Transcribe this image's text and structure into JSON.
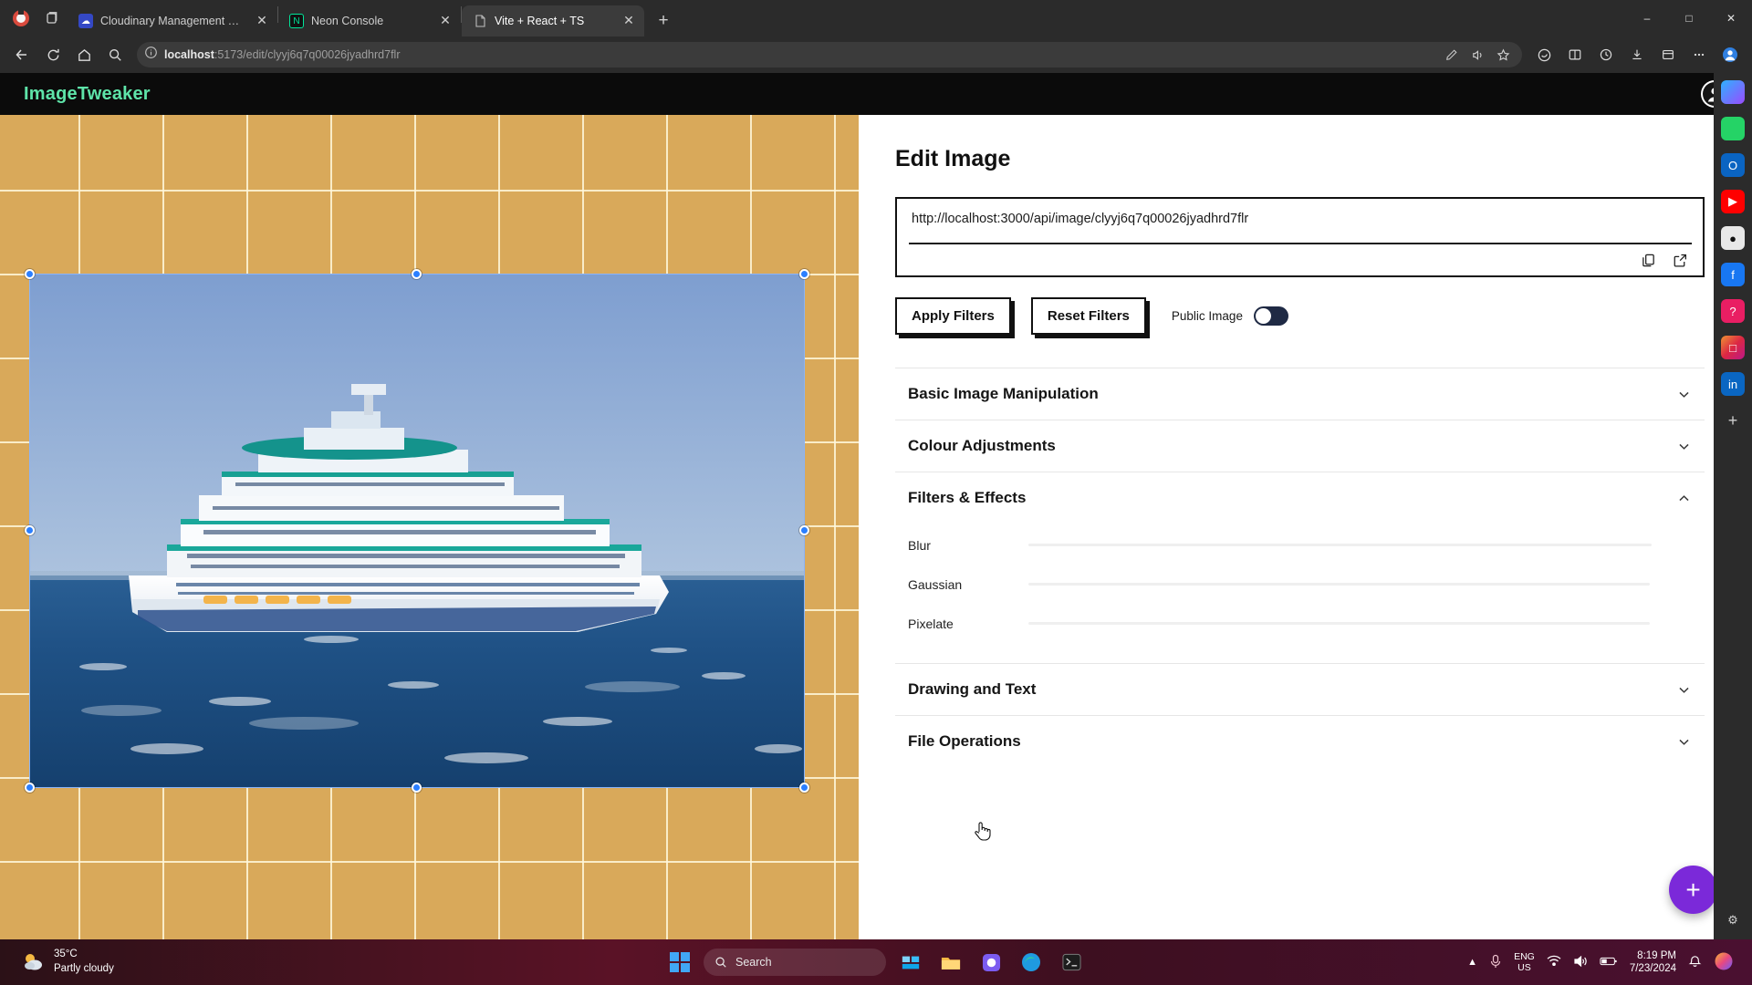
{
  "browser": {
    "tabs": [
      {
        "label": "Cloudinary Management Console",
        "active": false,
        "favicon": "cloudinary-icon",
        "favicon_color": "#3448c5"
      },
      {
        "label": "Neon Console",
        "active": false,
        "favicon": "neon-icon",
        "favicon_color": "#111111"
      },
      {
        "label": "Vite + React + TS",
        "active": true,
        "favicon": "document-icon",
        "favicon_color": "#555555"
      }
    ],
    "new_tab_label": "+",
    "window_controls": {
      "minimize": "–",
      "maximize": "□",
      "close": "✕"
    },
    "nav": {
      "back_icon": "back-arrow-icon",
      "refresh_icon": "refresh-icon",
      "home_icon": "home-icon",
      "search_icon": "search-icon"
    },
    "address": {
      "info_icon": "info-circle-icon",
      "host": "localhost",
      "path": ":5173/edit/clyyj6q7q00026jyadhrd7flr",
      "full_url": "localhost:5173/edit/clyyj6q7q00026jyadhrd7flr"
    },
    "omni_actions": [
      "pen-icon",
      "read-aloud-icon",
      "favorite-star-icon"
    ],
    "toolbar_right": [
      "copilot-icon",
      "split-screen-icon",
      "history-icon",
      "downloads-icon",
      "collections-icon",
      "more-icon",
      "profile-icon"
    ],
    "sidebar_icons": [
      "copilot-icon",
      "whatsapp-icon",
      "outlook-icon",
      "youtube-icon",
      "github-icon",
      "facebook-icon",
      "help-icon",
      "instagram-icon",
      "linkedin-icon",
      "add-icon",
      "settings-icon"
    ]
  },
  "app": {
    "brand": "ImageTweaker",
    "avatar_icon": "user-avatar-icon"
  },
  "editor": {
    "title": "Edit Image",
    "image_url": "http://localhost:3000/api/image/clyyj6q7q00026jyadhrd7flr",
    "url_actions": [
      {
        "name": "copy-icon",
        "label": "Copy"
      },
      {
        "name": "open-external-icon",
        "label": "Open in new tab"
      }
    ],
    "apply_button": "Apply Filters",
    "reset_button": "Reset Filters",
    "public_toggle_label": "Public Image",
    "public_toggle_on": true,
    "accordions": [
      {
        "title": "Basic Image Manipulation",
        "expanded": false,
        "chevron": "chevron-down-icon"
      },
      {
        "title": "Colour Adjustments",
        "expanded": false,
        "chevron": "chevron-down-icon"
      },
      {
        "title": "Filters & Effects",
        "expanded": true,
        "chevron": "chevron-up-icon",
        "sliders": [
          {
            "label": "Blur",
            "value": 0
          },
          {
            "label": "Gaussian",
            "value": 0
          },
          {
            "label": "Pixelate",
            "value": 0
          }
        ]
      },
      {
        "title": "Drawing and Text",
        "expanded": false,
        "chevron": "chevron-down-icon"
      },
      {
        "title": "File Operations",
        "expanded": false,
        "chevron": "chevron-down-icon"
      }
    ],
    "fab_label": "+",
    "fab_color": "#7b29d9",
    "canvas": {
      "background_color": "#d9a95a",
      "grid_line_color": "#fff8dc",
      "selection_color": "#2b7fff",
      "subject": "cruise ship on ocean photo"
    }
  },
  "taskbar": {
    "weather_temp": "35°C",
    "weather_desc": "Partly cloudy",
    "start_icon": "windows-start-icon",
    "search_placeholder": "Search",
    "apps": [
      "task-view-icon",
      "file-explorer-icon",
      "messenger-icon",
      "edge-icon",
      "terminal-icon"
    ],
    "tray": {
      "chevron": "show-hidden-icons-icon",
      "mic_icon": "microphone-icon",
      "language": "ENG",
      "language_sub": "US",
      "wifi_icon": "wifi-icon",
      "volume_icon": "speaker-icon",
      "battery_icon": "battery-icon",
      "time": "8:19 PM",
      "date": "7/23/2024",
      "notification_icon": "bell-icon",
      "copilot_icon": "copilot-taskbar-icon"
    }
  }
}
